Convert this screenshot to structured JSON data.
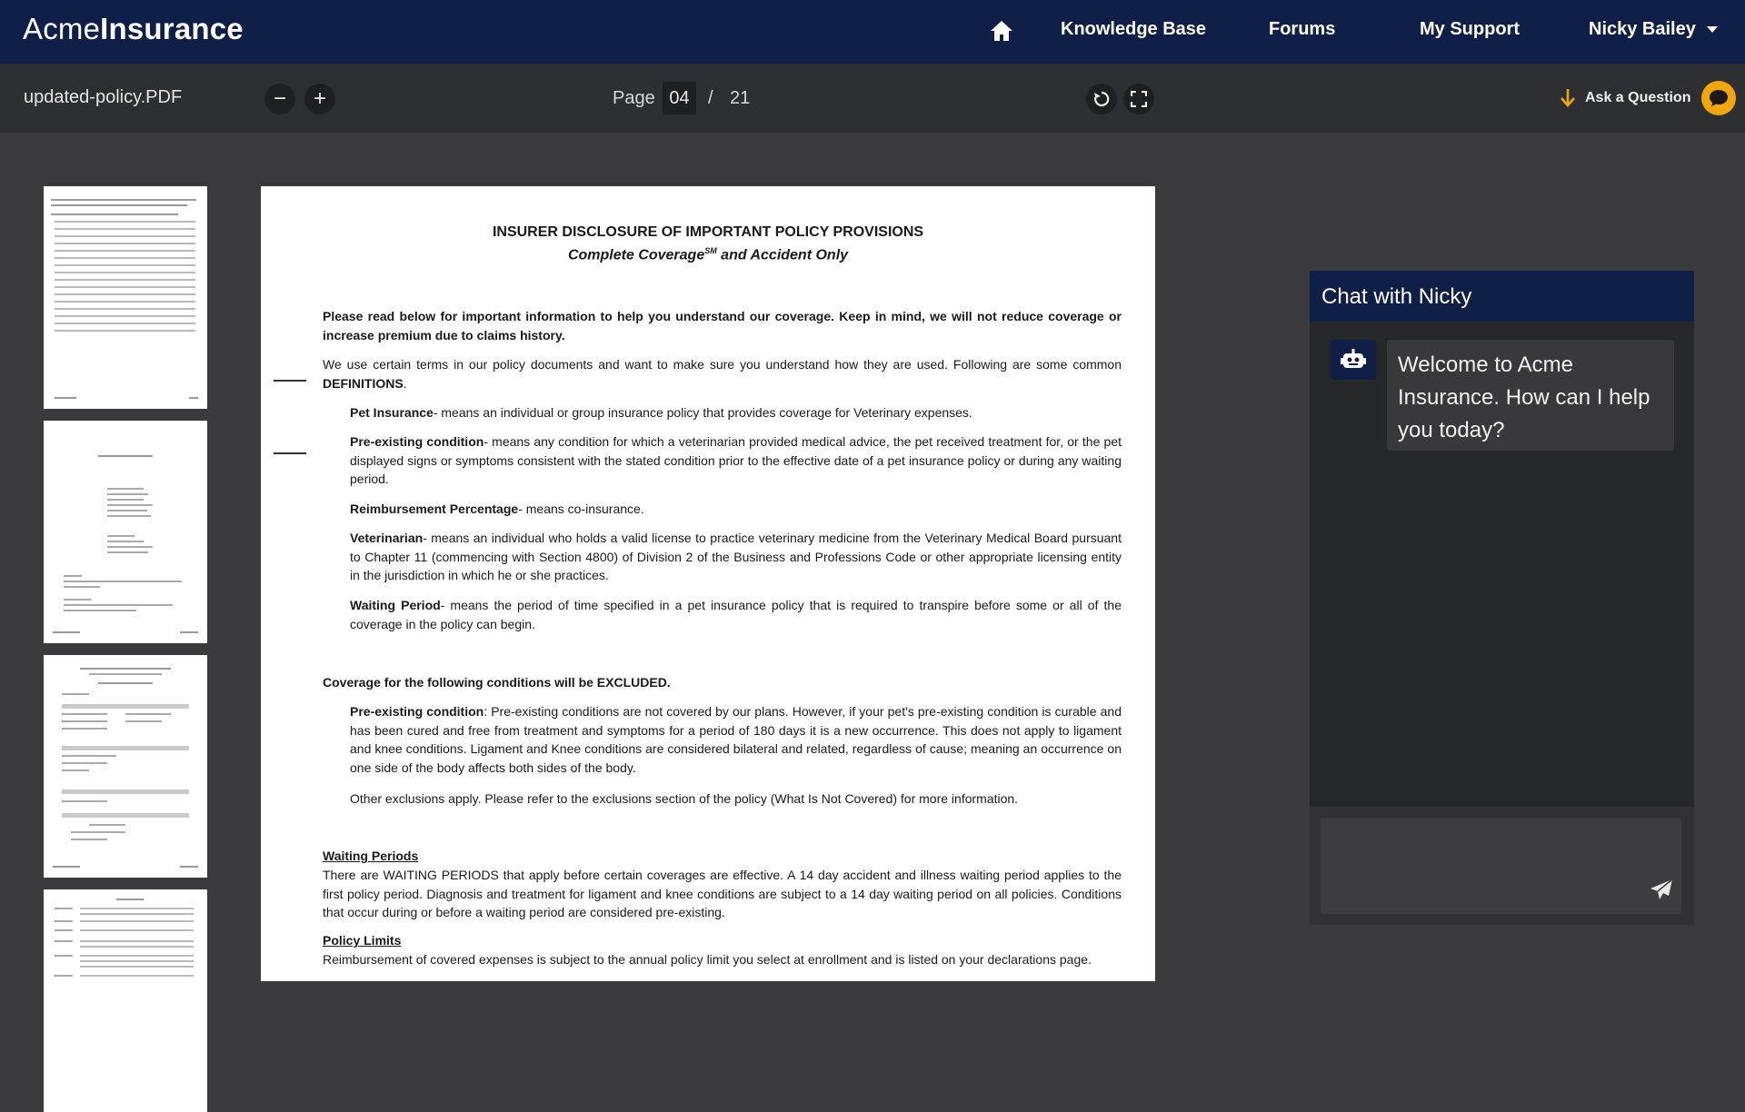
{
  "nav": {
    "logo_light": "Acme",
    "logo_bold": "Insurance",
    "links": [
      "Knowledge Base",
      "Forums",
      "My Support"
    ],
    "user": "Nicky Bailey"
  },
  "toolbar": {
    "filename": "updated-policy.PDF",
    "zoom_out": "−",
    "zoom_in": "+",
    "page_label": "Page",
    "page_current": "04",
    "page_sep": "/",
    "page_total": "21",
    "ask_label": "Ask a Question"
  },
  "document": {
    "title": "INSURER DISCLOSURE OF IMPORTANT POLICY PROVISIONS",
    "subtitle_a": "Complete Coverage",
    "subtitle_sup": "SM",
    "subtitle_b": " and Accident Only",
    "intro": "Please read below for important information to help you understand our coverage. Keep in mind, we will not reduce coverage or increase premium due to claims history.",
    "terms_lead": "We use certain terms in our policy documents and want to make sure you understand how they are used. Following are some common ",
    "terms_bold": "DEFINITIONS",
    "terms_end": ".",
    "definitions": [
      {
        "term": "Pet Insurance",
        "text": "- means an individual or group insurance policy that provides coverage for Veterinary expenses."
      },
      {
        "term": "Pre-existing condition",
        "text": "- means any condition for which a veterinarian provided medical advice, the pet received treatment for, or the pet displayed signs or symptoms consistent with the stated condition prior to the effective date of a pet insurance policy or during any waiting period."
      },
      {
        "term": "Reimbursement Percentage",
        "text": "- means co-insurance."
      },
      {
        "term": "Veterinarian",
        "text": "- means an individual who holds a valid license to practice veterinary medicine from the Veterinary Medical Board pursuant to Chapter 11 (commencing with Section 4800) of Division 2 of the Business and Professions Code or other appropriate licensing entity in the jurisdiction in which he or she practices."
      },
      {
        "term": "Waiting Period",
        "text": "- means the period of time specified in a pet insurance policy that is required to transpire before some or all of the coverage in the policy can begin."
      }
    ],
    "excluded_heading": "Coverage for the following conditions will be EXCLUDED.",
    "excluded_term": "Pre-existing condition",
    "excluded_text": ": Pre-existing conditions are not covered by our plans. However, if your pet's pre-existing condition is curable and has been cured and free from treatment and symptoms for a period of 180 days it is a new occurrence. This does not apply to ligament and knee conditions. Ligament and Knee conditions are considered bilateral and related, regardless of cause; meaning an occurrence on one side of the body affects both sides of the body.",
    "other_exclusions": "Other exclusions apply. Please refer to the exclusions section of the policy (What Is Not Covered) for more information.",
    "waiting_heading": "Waiting Periods",
    "waiting_text": "There are WAITING PERIODS that apply before certain coverages are effective. A 14 day accident and illness waiting period applies to the first policy period. Diagnosis and treatment for ligament and knee conditions are subject to a 14 day waiting period on all policies. Conditions that occur during or before a waiting period are considered pre-existing.",
    "limits_heading": "Policy Limits",
    "limits_text": "Reimbursement of covered expenses is subject to the annual policy limit you select at enrollment and is listed on your declarations page."
  },
  "chat": {
    "title": "Chat with Nicky",
    "welcome": "Welcome to Acme Insurance. How can I help you today?",
    "input_value": ""
  },
  "colors": {
    "nav_bg": "#0f1f48",
    "toolbar_bg": "#2e2f32",
    "viewer_bg": "#3b3b3e",
    "accent": "#f2a60c"
  },
  "icons": [
    "home-icon",
    "caret-down-icon",
    "zoom-out-icon",
    "zoom-in-icon",
    "rotate-icon",
    "fullscreen-icon",
    "download-arrow-icon",
    "chat-bubble-icon",
    "robot-icon",
    "send-icon"
  ]
}
